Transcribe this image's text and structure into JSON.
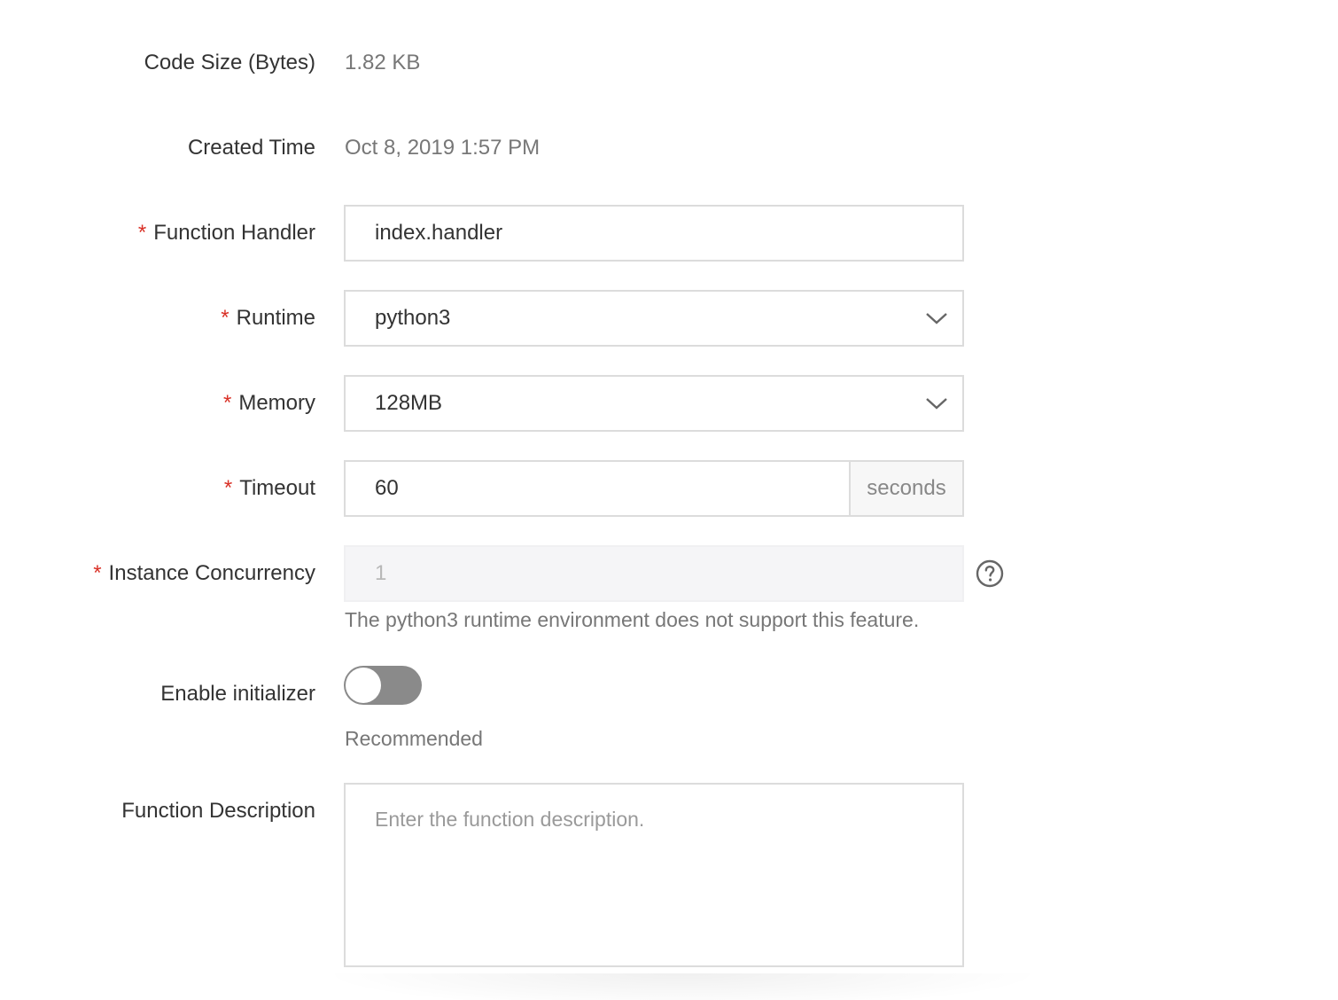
{
  "fields": {
    "code_size": {
      "label": "Code Size (Bytes)",
      "value": "1.82 KB"
    },
    "created_time": {
      "label": "Created Time",
      "value": "Oct 8, 2019 1:57 PM"
    },
    "function_handler": {
      "label": "Function Handler",
      "required_mark": "*",
      "value": "index.handler"
    },
    "runtime": {
      "label": "Runtime",
      "required_mark": "*",
      "selected": "python3",
      "icon": "chevron-down-icon"
    },
    "memory": {
      "label": "Memory",
      "required_mark": "*",
      "selected": "128MB",
      "icon": "chevron-down-icon"
    },
    "timeout": {
      "label": "Timeout",
      "required_mark": "*",
      "value": "60",
      "suffix": "seconds"
    },
    "instance_concurrency": {
      "label": "Instance Concurrency",
      "required_mark": "*",
      "value": "1",
      "disabled": true,
      "help_icon": "question-circle-icon",
      "note": "The python3 runtime environment does not support this feature."
    },
    "enable_initializer": {
      "label": "Enable initializer",
      "enabled": false,
      "hint": "Recommended"
    },
    "function_description": {
      "label": "Function Description",
      "placeholder": "Enter the function description.",
      "value": ""
    }
  },
  "colors": {
    "required": "#d93026",
    "border": "#dcdcdc",
    "toggle_off": "#8a8a8a",
    "disabled_bg": "#f5f5f7"
  }
}
